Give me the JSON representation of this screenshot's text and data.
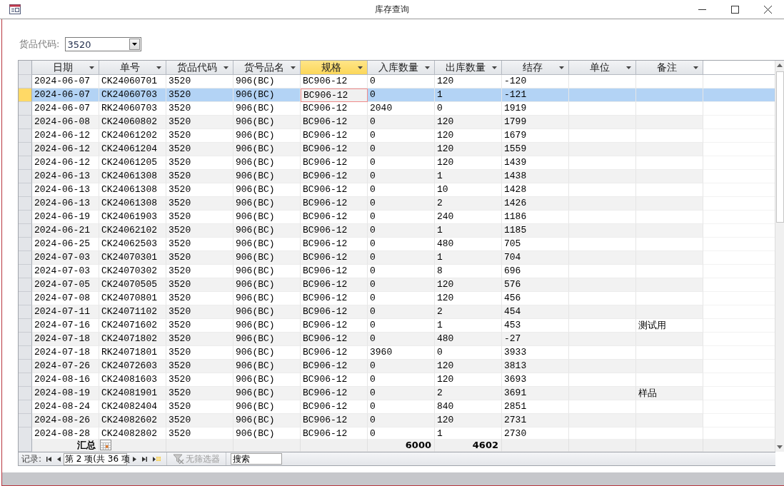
{
  "window": {
    "title": "库存查询"
  },
  "filter": {
    "label": "货品代码:",
    "value": "3520"
  },
  "table": {
    "columns": [
      {
        "label": "日期",
        "selected": false
      },
      {
        "label": "单号",
        "selected": false
      },
      {
        "label": "货品代码",
        "selected": false
      },
      {
        "label": "货号品名",
        "selected": false
      },
      {
        "label": "规格",
        "selected": true
      },
      {
        "label": "入库数量",
        "selected": false,
        "total": "6000"
      },
      {
        "label": "出库数量",
        "selected": false,
        "total": "4602"
      },
      {
        "label": "结存",
        "selected": false
      },
      {
        "label": "单位",
        "selected": false
      },
      {
        "label": "备注",
        "selected": false
      }
    ],
    "rows": [
      {
        "date": "2024-06-07",
        "number": "CK24060701",
        "item_code": "3520",
        "item_name": "906(BC)",
        "spec": "BC906-12",
        "qty_in": "0",
        "qty_out": "120",
        "balance": "-120",
        "selected": false
      },
      {
        "date": "2024-06-07",
        "number": "CK24060703",
        "item_code": "3520",
        "item_name": "906(BC)",
        "spec": "BC906-12",
        "qty_in": "0",
        "qty_out": "1",
        "balance": "-121",
        "selected": true
      },
      {
        "date": "2024-06-07",
        "number": "RK24060703",
        "item_code": "3520",
        "item_name": "906(BC)",
        "spec": "BC906-12",
        "qty_in": "2040",
        "qty_out": "0",
        "balance": "1919",
        "selected": false
      },
      {
        "date": "2024-06-08",
        "number": "CK24060802",
        "item_code": "3520",
        "item_name": "906(BC)",
        "spec": "BC906-12",
        "qty_in": "0",
        "qty_out": "120",
        "balance": "1799",
        "selected": false
      },
      {
        "date": "2024-06-12",
        "number": "CK24061202",
        "item_code": "3520",
        "item_name": "906(BC)",
        "spec": "BC906-12",
        "qty_in": "0",
        "qty_out": "120",
        "balance": "1679",
        "selected": false
      },
      {
        "date": "2024-06-12",
        "number": "CK24061204",
        "item_code": "3520",
        "item_name": "906(BC)",
        "spec": "BC906-12",
        "qty_in": "0",
        "qty_out": "120",
        "balance": "1559",
        "selected": false
      },
      {
        "date": "2024-06-12",
        "number": "CK24061205",
        "item_code": "3520",
        "item_name": "906(BC)",
        "spec": "BC906-12",
        "qty_in": "0",
        "qty_out": "120",
        "balance": "1439",
        "selected": false
      },
      {
        "date": "2024-06-13",
        "number": "CK24061308",
        "item_code": "3520",
        "item_name": "906(BC)",
        "spec": "BC906-12",
        "qty_in": "0",
        "qty_out": "1",
        "balance": "1438",
        "selected": false
      },
      {
        "date": "2024-06-13",
        "number": "CK24061308",
        "item_code": "3520",
        "item_name": "906(BC)",
        "spec": "BC906-12",
        "qty_in": "0",
        "qty_out": "10",
        "balance": "1428",
        "selected": false
      },
      {
        "date": "2024-06-13",
        "number": "CK24061308",
        "item_code": "3520",
        "item_name": "906(BC)",
        "spec": "BC906-12",
        "qty_in": "0",
        "qty_out": "2",
        "balance": "1426",
        "selected": false
      },
      {
        "date": "2024-06-19",
        "number": "CK24061903",
        "item_code": "3520",
        "item_name": "906(BC)",
        "spec": "BC906-12",
        "qty_in": "0",
        "qty_out": "240",
        "balance": "1186",
        "selected": false
      },
      {
        "date": "2024-06-21",
        "number": "CK24062102",
        "item_code": "3520",
        "item_name": "906(BC)",
        "spec": "BC906-12",
        "qty_in": "0",
        "qty_out": "1",
        "balance": "1185",
        "selected": false
      },
      {
        "date": "2024-06-25",
        "number": "CK24062503",
        "item_code": "3520",
        "item_name": "906(BC)",
        "spec": "BC906-12",
        "qty_in": "0",
        "qty_out": "480",
        "balance": "705",
        "selected": false
      },
      {
        "date": "2024-07-03",
        "number": "CK24070301",
        "item_code": "3520",
        "item_name": "906(BC)",
        "spec": "BC906-12",
        "qty_in": "0",
        "qty_out": "1",
        "balance": "704",
        "selected": false
      },
      {
        "date": "2024-07-03",
        "number": "CK24070302",
        "item_code": "3520",
        "item_name": "906(BC)",
        "spec": "BC906-12",
        "qty_in": "0",
        "qty_out": "8",
        "balance": "696",
        "selected": false
      },
      {
        "date": "2024-07-05",
        "number": "CK24070505",
        "item_code": "3520",
        "item_name": "906(BC)",
        "spec": "BC906-12",
        "qty_in": "0",
        "qty_out": "120",
        "balance": "576",
        "selected": false
      },
      {
        "date": "2024-07-08",
        "number": "CK24070801",
        "item_code": "3520",
        "item_name": "906(BC)",
        "spec": "BC906-12",
        "qty_in": "0",
        "qty_out": "120",
        "balance": "456",
        "selected": false
      },
      {
        "date": "2024-07-11",
        "number": "CK24071102",
        "item_code": "3520",
        "item_name": "906(BC)",
        "spec": "BC906-12",
        "qty_in": "0",
        "qty_out": "2",
        "balance": "454",
        "selected": false
      },
      {
        "date": "2024-07-16",
        "number": "CK24071602",
        "item_code": "3520",
        "item_name": "906(BC)",
        "spec": "BC906-12",
        "qty_in": "0",
        "qty_out": "1",
        "balance": "453",
        "note": "测试用",
        "selected": false
      },
      {
        "date": "2024-07-18",
        "number": "CK24071802",
        "item_code": "3520",
        "item_name": "906(BC)",
        "spec": "BC906-12",
        "qty_in": "0",
        "qty_out": "480",
        "balance": "-27",
        "selected": false
      },
      {
        "date": "2024-07-18",
        "number": "RK24071801",
        "item_code": "3520",
        "item_name": "906(BC)",
        "spec": "BC906-12",
        "qty_in": "3960",
        "qty_out": "0",
        "balance": "3933",
        "selected": false
      },
      {
        "date": "2024-07-26",
        "number": "CK24072603",
        "item_code": "3520",
        "item_name": "906(BC)",
        "spec": "BC906-12",
        "qty_in": "0",
        "qty_out": "120",
        "balance": "3813",
        "selected": false
      },
      {
        "date": "2024-08-16",
        "number": "CK24081603",
        "item_code": "3520",
        "item_name": "906(BC)",
        "spec": "BC906-12",
        "qty_in": "0",
        "qty_out": "120",
        "balance": "3693",
        "selected": false
      },
      {
        "date": "2024-08-19",
        "number": "CK24081901",
        "item_code": "3520",
        "item_name": "906(BC)",
        "spec": "BC906-12",
        "qty_in": "0",
        "qty_out": "2",
        "balance": "3691",
        "note": "样品",
        "selected": false
      },
      {
        "date": "2024-08-24",
        "number": "CK24082404",
        "item_code": "3520",
        "item_name": "906(BC)",
        "spec": "BC906-12",
        "qty_in": "0",
        "qty_out": "840",
        "balance": "2851",
        "selected": false
      },
      {
        "date": "2024-08-26",
        "number": "CK24082602",
        "item_code": "3520",
        "item_name": "906(BC)",
        "spec": "BC906-12",
        "qty_in": "0",
        "qty_out": "120",
        "balance": "2731",
        "selected": false
      },
      {
        "date": "2024-08-28",
        "number": "CK24082802",
        "item_code": "3520",
        "item_name": "906(BC)",
        "spec": "BC906-12",
        "qty_in": "0",
        "qty_out": "1",
        "balance": "2730",
        "selected": false
      }
    ],
    "totals_label": "汇总"
  },
  "navigator": {
    "label": "记录:",
    "position": "第 2 项(共 36 项",
    "filter": {
      "label": "无筛选器",
      "disabled": true
    },
    "search": {
      "placeholder": "搜索"
    }
  }
}
